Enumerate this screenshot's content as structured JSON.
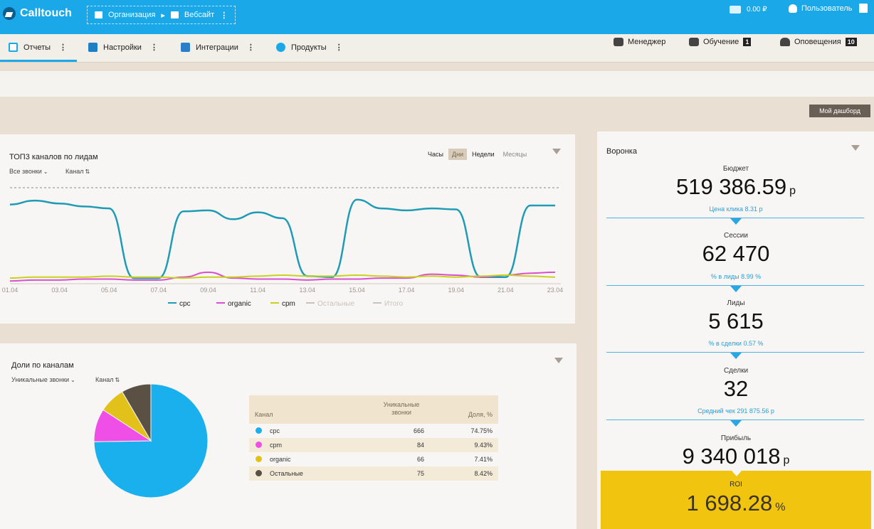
{
  "app": {
    "name": "Calltouch"
  },
  "breadcrumb": {
    "org": "Организация",
    "site": "Вебсайт"
  },
  "header": {
    "balance": "0.00 ₽",
    "user": "Пользователь"
  },
  "nav": {
    "items": [
      {
        "label": "Отчеты"
      },
      {
        "label": "Настройки"
      },
      {
        "label": "Интеграции"
      },
      {
        "label": "Продукты"
      }
    ],
    "manager": "Менеджер",
    "training": "Обучение",
    "training_badge": "1",
    "alerts": "Оповещения",
    "alerts_badge": "10"
  },
  "dashboard_button": "Мой дашборд",
  "top_channels": {
    "title": "ТОП3 каналов по лидам",
    "filter_calls": "Все звонки",
    "filter_channel": "Канал",
    "periods": [
      "Часы",
      "Дни",
      "Недели",
      "Месяцы"
    ],
    "active_period": "Дни"
  },
  "shares": {
    "title": "Доли по каналам",
    "filter_calls": "Уникальные звонки",
    "filter_channel": "Канал",
    "columns": [
      "Канал",
      "Уникальные звонки",
      "Доля, %"
    ],
    "rows": [
      {
        "channel": "cpc",
        "calls": "666",
        "share": "74.75%",
        "color": "#1ab0ee"
      },
      {
        "channel": "cpm",
        "calls": "84",
        "share": "9.43%",
        "color": "#ef4fe6"
      },
      {
        "channel": "organic",
        "calls": "66",
        "share": "7.41%",
        "color": "#e2c21a"
      },
      {
        "channel": "Остальные",
        "calls": "75",
        "share": "8.42%",
        "color": "#5b5044"
      }
    ]
  },
  "funnel": {
    "title": "Воронка",
    "budget_label": "Бюджет",
    "budget_value": "519 386.59",
    "budget_unit": "р",
    "click_price": "Цена клика 8.31 р",
    "sessions_label": "Сессии",
    "sessions_value": "62 470",
    "lead_rate": "% в лиды 8.99 %",
    "leads_label": "Лиды",
    "leads_value": "5 615",
    "deal_rate": "% в сделки 0.57 %",
    "deals_label": "Сделки",
    "deals_value": "32",
    "avg_check": "Средний чек 291 875.56 р",
    "profit_label": "Прибыль",
    "profit_value": "9 340 018",
    "profit_unit": "р",
    "roi_label": "ROI",
    "roi_value": "1 698.28",
    "roi_unit": "%"
  },
  "chart_data": [
    {
      "type": "line",
      "x": [
        "01.04",
        "02.04",
        "03.04",
        "04.04",
        "05.04",
        "06.04",
        "07.04",
        "08.04",
        "09.04",
        "10.04",
        "11.04",
        "12.04",
        "13.04",
        "14.04",
        "15.04",
        "16.04",
        "17.04",
        "18.04",
        "19.04",
        "20.04",
        "21.04",
        "22.04",
        "23.04"
      ],
      "x_ticks": [
        "01.04",
        "03.04",
        "05.04",
        "07.04",
        "09.04",
        "11.04",
        "13.04",
        "15.04",
        "17.04",
        "19.04",
        "21.04",
        "23.04"
      ],
      "series": [
        {
          "name": "cpc",
          "color": "#1f9bb5",
          "values": [
            80,
            84,
            81,
            78,
            76,
            5,
            5,
            73,
            74,
            65,
            72,
            66,
            7,
            6,
            85,
            76,
            74,
            76,
            75,
            6,
            6,
            79,
            79
          ]
        },
        {
          "name": "organic",
          "color": "#d94fd0",
          "values": [
            2,
            3,
            3,
            4,
            4,
            3,
            3,
            6,
            11,
            5,
            4,
            4,
            3,
            4,
            4,
            5,
            5,
            9,
            8,
            6,
            8,
            10,
            11
          ]
        },
        {
          "name": "cpm",
          "color": "#c9d11c",
          "values": [
            5,
            6,
            6,
            6,
            7,
            6,
            6,
            5,
            6,
            6,
            7,
            8,
            7,
            7,
            8,
            7,
            6,
            7,
            6,
            7,
            8,
            7,
            6
          ]
        },
        {
          "name": "Остальные",
          "color": "#c9c3bb",
          "values": []
        },
        {
          "name": "Итого",
          "color": "#c9c3bb",
          "values": []
        }
      ],
      "ylim": [
        0,
        100
      ],
      "grid": false,
      "legend": "bottom"
    },
    {
      "type": "pie",
      "labels": [
        "cpc",
        "cpm",
        "organic",
        "Остальные"
      ],
      "values": [
        74.75,
        9.43,
        7.41,
        8.42
      ],
      "colors": [
        "#1ab0ee",
        "#ef4fe6",
        "#e2c21a",
        "#5b5044"
      ]
    }
  ]
}
